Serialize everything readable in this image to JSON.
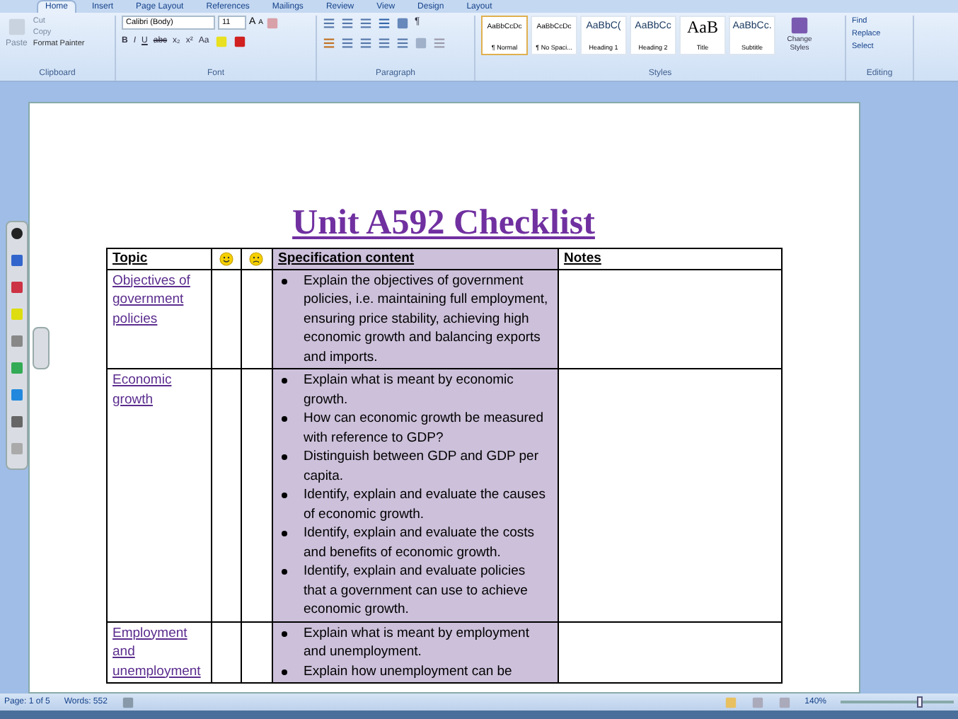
{
  "ribbon_tabs": [
    {
      "label": "Home",
      "selected": true
    },
    {
      "label": "Insert",
      "selected": false
    },
    {
      "label": "Page Layout",
      "selected": false
    },
    {
      "label": "References",
      "selected": false
    },
    {
      "label": "Mailings",
      "selected": false
    },
    {
      "label": "Review",
      "selected": false
    },
    {
      "label": "View",
      "selected": false
    },
    {
      "label": "Design",
      "selected": false
    },
    {
      "label": "Layout",
      "selected": false
    }
  ],
  "clipboard": {
    "paste": "Paste",
    "cut": "Cut",
    "copy": "Copy",
    "format_painter": "Format Painter",
    "label": "Clipboard"
  },
  "font": {
    "name": "Calibri (Body)",
    "size": "11",
    "label": "Font",
    "bold": "B",
    "italic": "I",
    "underline": "U",
    "strike": "abc",
    "subscript": "x₂",
    "superscript": "x²",
    "case": "Aa",
    "grow": "A",
    "shrink": "A"
  },
  "paragraph": {
    "label": "Paragraph",
    "pilcrow": "¶"
  },
  "styles": {
    "label": "Styles",
    "items": [
      {
        "sample": "AaBbCcDc",
        "name": "¶ Normal",
        "selected": true
      },
      {
        "sample": "AaBbCcDc",
        "name": "¶ No Spaci...",
        "selected": false
      },
      {
        "sample": "AaBbC(",
        "name": "Heading 1",
        "selected": false
      },
      {
        "sample": "AaBbCc",
        "name": "Heading 2",
        "selected": false
      },
      {
        "sample": "AaB",
        "name": "Title",
        "selected": false
      },
      {
        "sample": "AaBbCc.",
        "name": "Subtitle",
        "selected": false
      }
    ],
    "change": "Change Styles"
  },
  "editing": {
    "label": "Editing",
    "items": [
      "Find",
      "Replace",
      "Select"
    ]
  },
  "document": {
    "title": "Unit A592 Checklist",
    "columns": [
      "Topic",
      "Specification content",
      "Notes"
    ],
    "rows": [
      {
        "topic": "Objectives of government policies",
        "points": [
          "Explain the objectives of government policies, i.e. maintaining full employment, ensuring price stability, achieving high economic growth and balancing exports and imports."
        ]
      },
      {
        "topic": "Economic growth",
        "points": [
          "Explain what is meant by economic growth.",
          "How can economic growth be measured with reference to GDP?",
          "Distinguish between GDP and GDP per capita.",
          "Identify, explain and evaluate the causes of economic growth.",
          "Identify, explain and evaluate the costs and benefits of economic growth.",
          "Identify, explain and evaluate policies that a government can use to achieve economic growth."
        ]
      },
      {
        "topic": "Employment and unemployment",
        "points": [
          "Explain what is meant by employment and unemployment.",
          "Explain how unemployment can be"
        ]
      }
    ]
  },
  "status_bar": {
    "page": "Page: 1 of 5",
    "words": "Words: 552",
    "zoom": "140%",
    "level": 0.7
  }
}
